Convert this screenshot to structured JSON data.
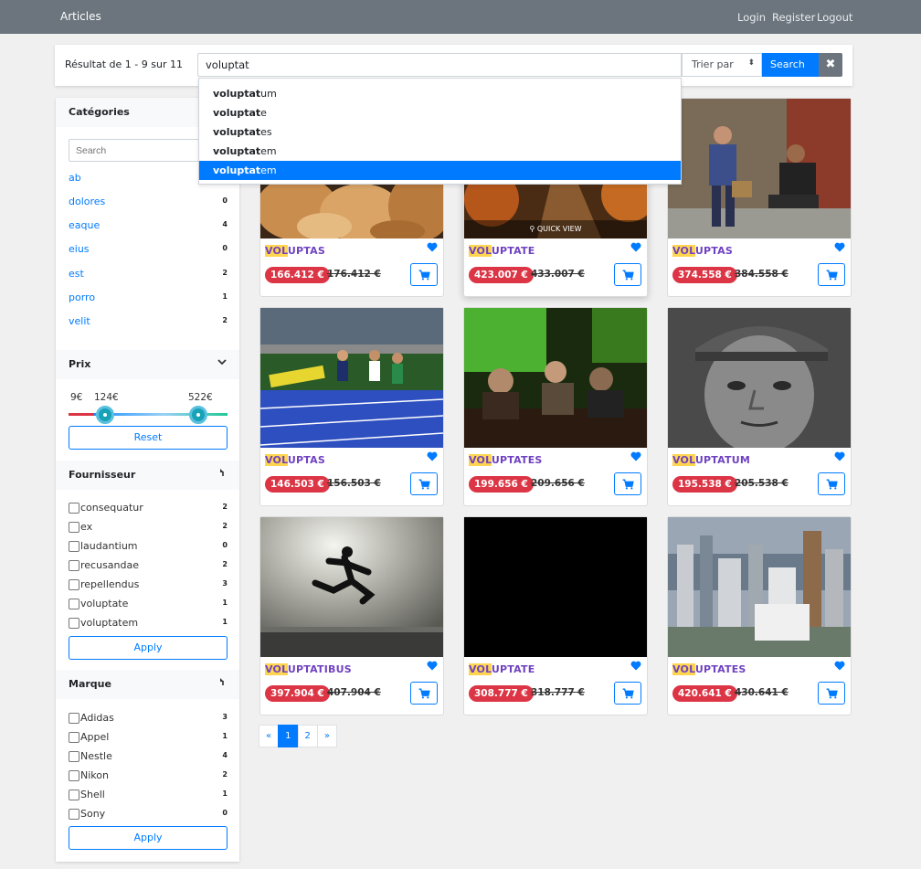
{
  "navbar": {
    "brand": "Articles",
    "links": [
      "Login",
      "Register",
      "Logout"
    ]
  },
  "search": {
    "result_text": "Résultat de 1 - 9 sur 11",
    "query": "voluptat",
    "sort_label": "Trier par",
    "search_button": "Search ...",
    "suggestions": [
      {
        "match": "voluptat",
        "rest": "um"
      },
      {
        "match": "voluptat",
        "rest": "e"
      },
      {
        "match": "voluptat",
        "rest": "es"
      },
      {
        "match": "voluptat",
        "rest": "em"
      },
      {
        "match": "voluptat",
        "rest": "em"
      }
    ],
    "active_suggestion": 4
  },
  "sidebar": {
    "categories": {
      "title": "Catégories",
      "search_placeholder": "Search",
      "items": [
        {
          "label": "ab",
          "count": ""
        },
        {
          "label": "dolores",
          "count": "0"
        },
        {
          "label": "eaque",
          "count": "4"
        },
        {
          "label": "eius",
          "count": "0"
        },
        {
          "label": "est",
          "count": "2"
        },
        {
          "label": "porro",
          "count": "1"
        },
        {
          "label": "velit",
          "count": "2"
        }
      ]
    },
    "price": {
      "title": "Prix",
      "min": "9€",
      "low": "124€",
      "high": "522€",
      "reset": "Reset"
    },
    "supplier": {
      "title": "Fournisseur",
      "items": [
        {
          "label": "consequatur",
          "count": "2"
        },
        {
          "label": "ex",
          "count": "2"
        },
        {
          "label": "laudantium",
          "count": "0"
        },
        {
          "label": "recusandae",
          "count": "2"
        },
        {
          "label": "repellendus",
          "count": "3"
        },
        {
          "label": "voluptate",
          "count": "1"
        },
        {
          "label": "voluptatem",
          "count": "1"
        }
      ],
      "apply": "Apply"
    },
    "brand": {
      "title": "Marque",
      "items": [
        {
          "label": "Adidas",
          "count": "3"
        },
        {
          "label": "Appel",
          "count": "1"
        },
        {
          "label": "Nestle",
          "count": "4"
        },
        {
          "label": "Nikon",
          "count": "2"
        },
        {
          "label": "Shell",
          "count": "1"
        },
        {
          "label": "Sony",
          "count": "0"
        }
      ],
      "apply": "Apply"
    }
  },
  "products": [
    {
      "hl": "VOL",
      "rest": "UPTAS",
      "price": "166.412 €",
      "old": "176.412 €",
      "image": "bread"
    },
    {
      "hl": "VOL",
      "rest": "UPTATE",
      "price": "423.007 €",
      "old": "433.007 €",
      "image": "autumn-path",
      "quick_view": "QUICK VIEW"
    },
    {
      "hl": "VOL",
      "rest": "UPTAS",
      "price": "374.558 €",
      "old": "384.558 €",
      "image": "street-vendor"
    },
    {
      "hl": "VOL",
      "rest": "UPTAS",
      "price": "146.503 €",
      "old": "156.503 €",
      "image": "sprinters"
    },
    {
      "hl": "VOL",
      "rest": "UPTATES",
      "price": "199.656 €",
      "old": "209.656 €",
      "image": "bar-green"
    },
    {
      "hl": "VOL",
      "rest": "UPTATUM",
      "price": "195.538 €",
      "old": "205.538 €",
      "image": "old-man"
    },
    {
      "hl": "VOL",
      "rest": "UPTATIBUS",
      "price": "397.904 €",
      "old": "407.904 €",
      "image": "jump-kick"
    },
    {
      "hl": "VOL",
      "rest": "UPTATE",
      "price": "308.777 €",
      "old": "318.777 €",
      "image": "black"
    },
    {
      "hl": "VOL",
      "rest": "UPTATES",
      "price": "420.641 €",
      "old": "430.641 €",
      "image": "city-skyline"
    }
  ],
  "pagination": [
    "«",
    "1",
    "2",
    "»"
  ],
  "pagination_active": 1,
  "colors": {
    "primary": "#007bff",
    "danger": "#dc3545",
    "navbar": "#6c757d",
    "product_name": "#6f42c1",
    "highlight": "#ffd54f"
  }
}
